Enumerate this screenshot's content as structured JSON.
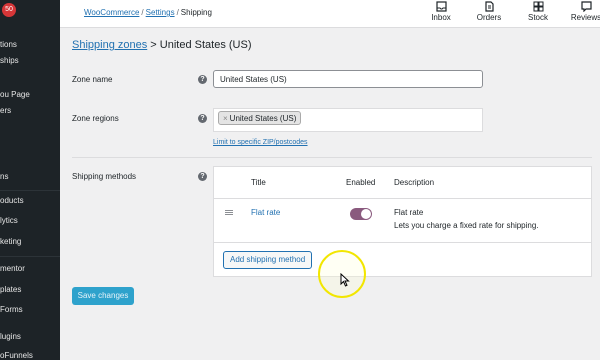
{
  "sidebar": {
    "badge": "50",
    "items": [
      "tions",
      "ships",
      "ou Page",
      "ers",
      "ns",
      "oducts",
      "lytics",
      "keting",
      "mentor",
      "plates",
      "Forms",
      "lugins",
      "oFunnels"
    ]
  },
  "breadcrumb": {
    "woocommerce": "WooCommerce",
    "settings": "Settings",
    "current": "Shipping"
  },
  "topbar": {
    "inbox": "Inbox",
    "orders": "Orders",
    "stock": "Stock",
    "reviews": "Reviews"
  },
  "page": {
    "title_link": "Shipping zones",
    "title_sep": ">",
    "title_rest": "United States (US)"
  },
  "form": {
    "zone_name_label": "Zone name",
    "zone_name_value": "United States (US)",
    "zone_regions_label": "Zone regions",
    "region_token": "United States (US)",
    "limit_link": "Limit to specific ZIP/postcodes",
    "shipping_methods_label": "Shipping methods",
    "help_glyph": "?"
  },
  "methods_table": {
    "headers": [
      "Title",
      "Enabled",
      "Description"
    ],
    "rows": [
      {
        "title": "Flat rate",
        "enabled": true,
        "description_title": "Flat rate",
        "description_text": "Lets you charge a fixed rate for shipping."
      }
    ],
    "add_button": "Add shipping method"
  },
  "save_button": "Save changes",
  "colors": {
    "accent": "#2271b1",
    "toggle_on": "#8a5a7e",
    "save_button": "#2ea2cc",
    "cursor_highlight": "#f2e600"
  }
}
